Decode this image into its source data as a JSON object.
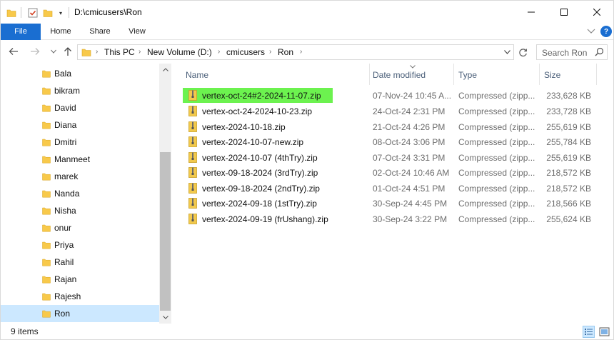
{
  "title_bar": {
    "path_title": "D:\\cmicusers\\Ron",
    "minimize": "—",
    "maximize": "☐",
    "close": "✕"
  },
  "ribbon": {
    "tabs": [
      {
        "label": "File"
      },
      {
        "label": "Home"
      },
      {
        "label": "Share"
      },
      {
        "label": "View"
      }
    ],
    "help": "?"
  },
  "address_bar": {
    "crumbs": [
      "This PC",
      "New Volume (D:)",
      "cmicusers",
      "Ron"
    ]
  },
  "search": {
    "placeholder": "Search Ron"
  },
  "nav_pane": {
    "items": [
      {
        "label": "Bala"
      },
      {
        "label": "bikram"
      },
      {
        "label": "David"
      },
      {
        "label": "Diana"
      },
      {
        "label": "Dmitri"
      },
      {
        "label": "Manmeet"
      },
      {
        "label": "marek"
      },
      {
        "label": "Nanda"
      },
      {
        "label": "Nisha"
      },
      {
        "label": "onur"
      },
      {
        "label": "Priya"
      },
      {
        "label": "Rahil"
      },
      {
        "label": "Rajan"
      },
      {
        "label": "Rajesh"
      },
      {
        "label": "Ron",
        "selected": true
      }
    ]
  },
  "columns": {
    "name": "Name",
    "date_modified": "Date modified",
    "type": "Type",
    "size": "Size"
  },
  "files": [
    {
      "name": "vertex-oct-24#2-2024-11-07.zip",
      "date": "07-Nov-24 10:45 A...",
      "type": "Compressed (zipp...",
      "size": "233,628 KB",
      "highlighted": true
    },
    {
      "name": "vertex-oct-24-2024-10-23.zip",
      "date": "24-Oct-24 2:31 PM",
      "type": "Compressed (zipp...",
      "size": "233,728 KB"
    },
    {
      "name": "vertex-2024-10-18.zip",
      "date": "21-Oct-24 4:26 PM",
      "type": "Compressed (zipp...",
      "size": "255,619 KB"
    },
    {
      "name": "vertex-2024-10-07-new.zip",
      "date": "08-Oct-24 3:06 PM",
      "type": "Compressed (zipp...",
      "size": "255,784 KB"
    },
    {
      "name": "vertex-2024-10-07 (4thTry).zip",
      "date": "07-Oct-24 3:31 PM",
      "type": "Compressed (zipp...",
      "size": "255,619 KB"
    },
    {
      "name": "vertex-09-18-2024 (3rdTry).zip",
      "date": "02-Oct-24 10:46 AM",
      "type": "Compressed (zipp...",
      "size": "218,572 KB"
    },
    {
      "name": "vertex-09-18-2024 (2ndTry).zip",
      "date": "01-Oct-24 4:51 PM",
      "type": "Compressed (zipp...",
      "size": "218,572 KB"
    },
    {
      "name": "vertex-2024-09-18 (1stTry).zip",
      "date": "30-Sep-24 4:45 PM",
      "type": "Compressed (zipp...",
      "size": "218,566 KB"
    },
    {
      "name": "vertex-2024-09-19 (frUshang).zip",
      "date": "30-Sep-24 3:22 PM",
      "type": "Compressed (zipp...",
      "size": "255,624 KB"
    }
  ],
  "status_bar": {
    "item_count": "9 items"
  },
  "colors": {
    "accent": "#1a6ed1",
    "selection": "#cce8ff",
    "highlight": "#6cf24f",
    "folder": "#f8c94a"
  }
}
